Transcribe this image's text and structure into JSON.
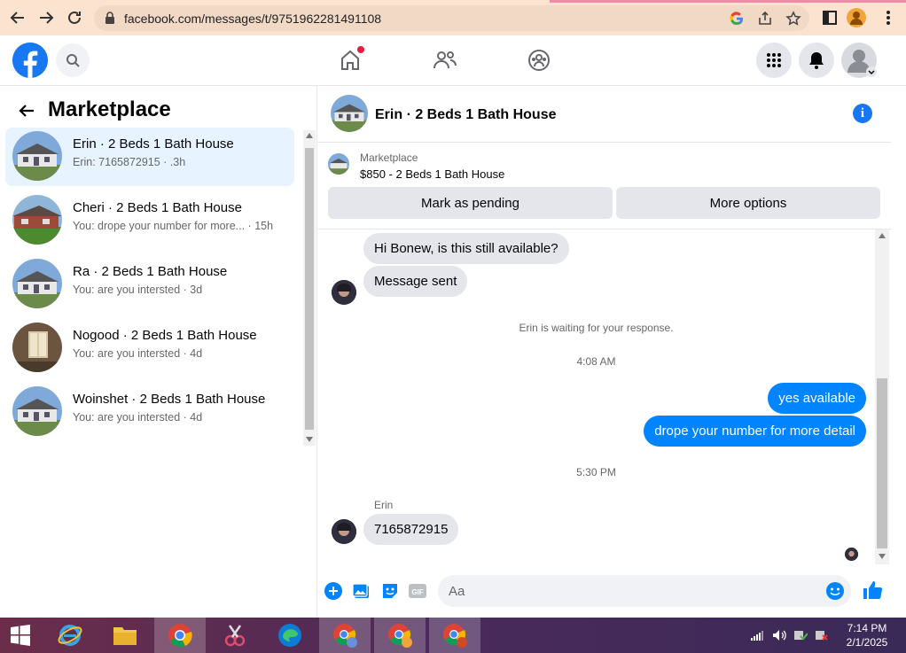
{
  "browser": {
    "url": "facebook.com/messages/t/9751962281491108"
  },
  "sidebar": {
    "title": "Marketplace",
    "conversations": [
      {
        "title": "Erin · 2 Beds 1 Bath House",
        "snippet": "Erin: 7165872915 · .3h"
      },
      {
        "title": "Cheri · 2 Beds 1 Bath House",
        "snippet": "You: drope your number for more... · 15h"
      },
      {
        "title": "Ra · 2 Beds 1 Bath House",
        "snippet": "You: are you intersted · 3d"
      },
      {
        "title": "Nogood · 2 Beds 1 Bath House",
        "snippet": "You: are you intersted · 4d"
      },
      {
        "title": "Woinshet · 2 Beds 1 Bath House",
        "snippet": "You: are you intersted · 4d"
      }
    ]
  },
  "chat": {
    "title": "Erin · 2 Beds 1 Bath House",
    "listing_label": "Marketplace",
    "listing_price": "$850 - 2 Beds 1 Bath House",
    "mark_pending": "Mark as pending",
    "more_options": "More options",
    "messages": {
      "m1": "Hi Bonew, is this still available?",
      "m2": "Message sent",
      "waiting": "Erin is waiting for your response.",
      "time1": "4:08 AM",
      "out1": "yes available",
      "out2": "drope your number for more detail",
      "time2": "5:30 PM",
      "sender": "Erin",
      "m3": "7165872915"
    },
    "composer_placeholder": "Aa"
  },
  "taskbar": {
    "time": "7:14 PM",
    "date": "2/1/2025"
  },
  "colors": {
    "fb_blue": "#1877f2",
    "messenger_blue": "#0084ff"
  }
}
